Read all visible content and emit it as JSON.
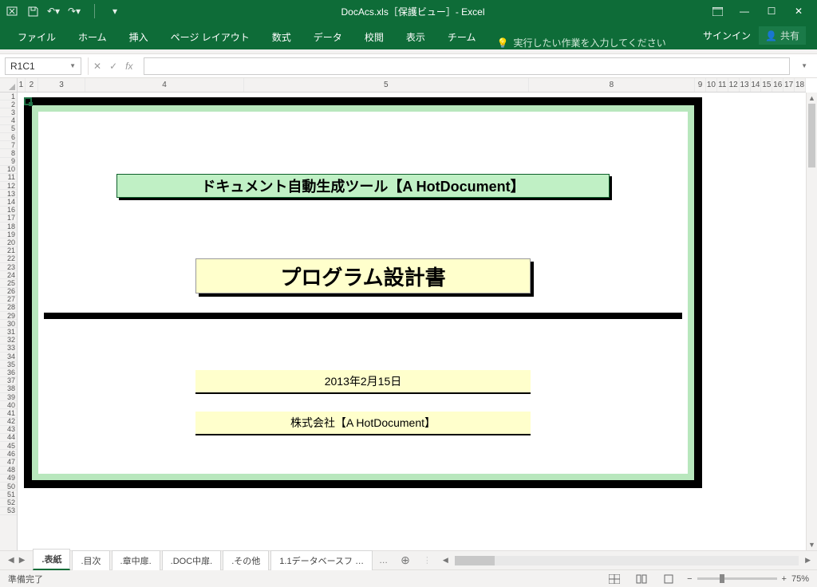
{
  "titlebar": {
    "title": "DocAcs.xls［保護ビュー］- Excel"
  },
  "ribbon": {
    "tabs": {
      "file": "ファイル",
      "home": "ホーム",
      "insert": "挿入",
      "pagelayout": "ページ レイアウト",
      "formulas": "数式",
      "data": "データ",
      "review": "校閲",
      "view": "表示",
      "team": "チーム"
    },
    "tell_me": "実行したい作業を入力してください",
    "sign_in": "サインイン",
    "share": "共有"
  },
  "formula_bar": {
    "name_box": "R1C1",
    "fx_label": "fx",
    "value": ""
  },
  "col_headers": [
    "1",
    "2",
    "3",
    "4",
    "5",
    "8",
    "9",
    "10",
    "11",
    "12",
    "13",
    "14",
    "15",
    "16",
    "17",
    "18"
  ],
  "row_headers": [
    "1",
    "2",
    "3",
    "4",
    "5",
    "6",
    "7",
    "8",
    "9",
    "10",
    "11",
    "12",
    "13",
    "14",
    "16",
    "17",
    "18",
    "19",
    "20",
    "21",
    "22",
    "23",
    "24",
    "25",
    "26",
    "27",
    "28",
    "29",
    "30",
    "31",
    "32",
    "33",
    "34",
    "35",
    "36",
    "37",
    "38",
    "39",
    "40",
    "41",
    "42",
    "43",
    "44",
    "45",
    "46",
    "47",
    "48",
    "49",
    "50",
    "51",
    "52",
    "53"
  ],
  "cover": {
    "banner": "ドキュメント自動生成ツール【A HotDocument】",
    "doc_title": "プログラム設計書",
    "date": "2013年2月15日",
    "company": "株式会社【A HotDocument】"
  },
  "sheet_tabs": {
    "active": ".表紙",
    "tabs": [
      ".表紙",
      ".目次",
      ".章中扉.",
      ".DOC中扉.",
      ".その他",
      "1.1データベースフ …"
    ],
    "more": "…"
  },
  "statusbar": {
    "ready": "準備完了",
    "zoom": "75%"
  }
}
